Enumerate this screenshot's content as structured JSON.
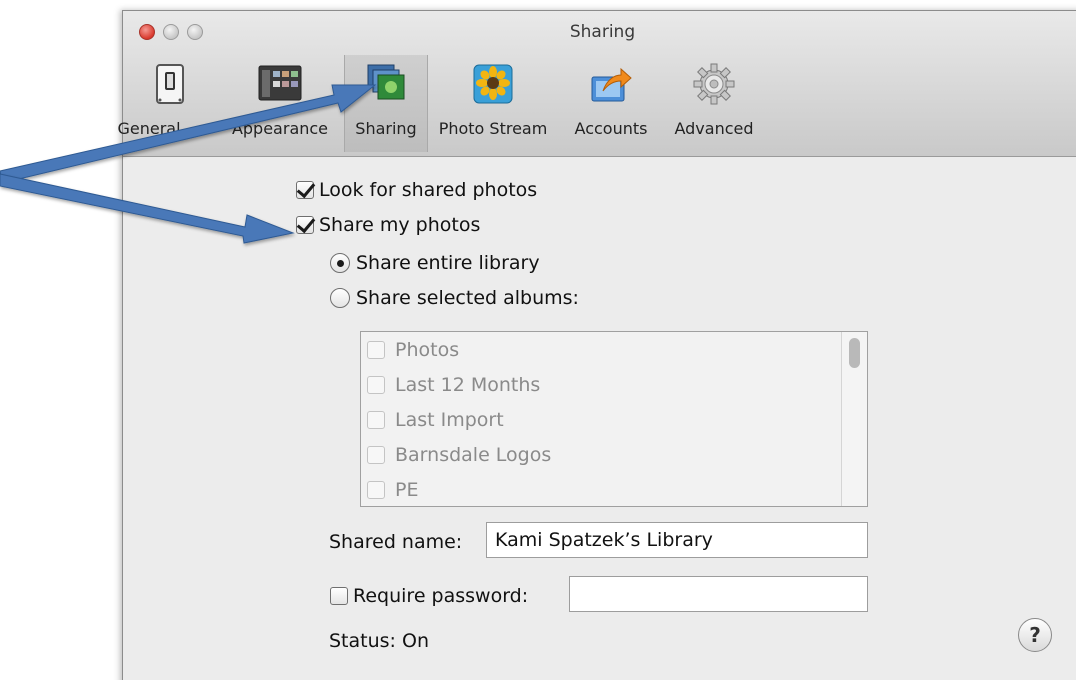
{
  "window": {
    "title": "Sharing"
  },
  "toolbar": {
    "items": [
      {
        "label": "General",
        "icon": "switch-icon"
      },
      {
        "label": "Appearance",
        "icon": "appearance-icon"
      },
      {
        "label": "Sharing",
        "icon": "sharing-icon",
        "selected": true
      },
      {
        "label": "Photo Stream",
        "icon": "sunflower-icon"
      },
      {
        "label": "Accounts",
        "icon": "accounts-arrow-icon"
      },
      {
        "label": "Advanced",
        "icon": "gear-icon"
      }
    ]
  },
  "sharing": {
    "look_for_shared": {
      "label": "Look for shared photos",
      "checked": true
    },
    "share_my_photos": {
      "label": "Share my photos",
      "checked": true
    },
    "share_entire_library": {
      "label": "Share entire library",
      "selected": true
    },
    "share_selected_albums": {
      "label": "Share selected albums:",
      "selected": false
    },
    "albums": [
      "Photos",
      "Last 12 Months",
      "Last Import",
      "Barnsdale Logos",
      "PE"
    ],
    "shared_name_label": "Shared name:",
    "shared_name_value": "Kami Spatzek’s Library",
    "require_password": {
      "label": "Require password:",
      "checked": false
    },
    "password_value": "",
    "status": "Status:  On",
    "help_label": "?"
  },
  "colors": {
    "arrow": "#4a78b8",
    "close_button": "#d9392d"
  }
}
